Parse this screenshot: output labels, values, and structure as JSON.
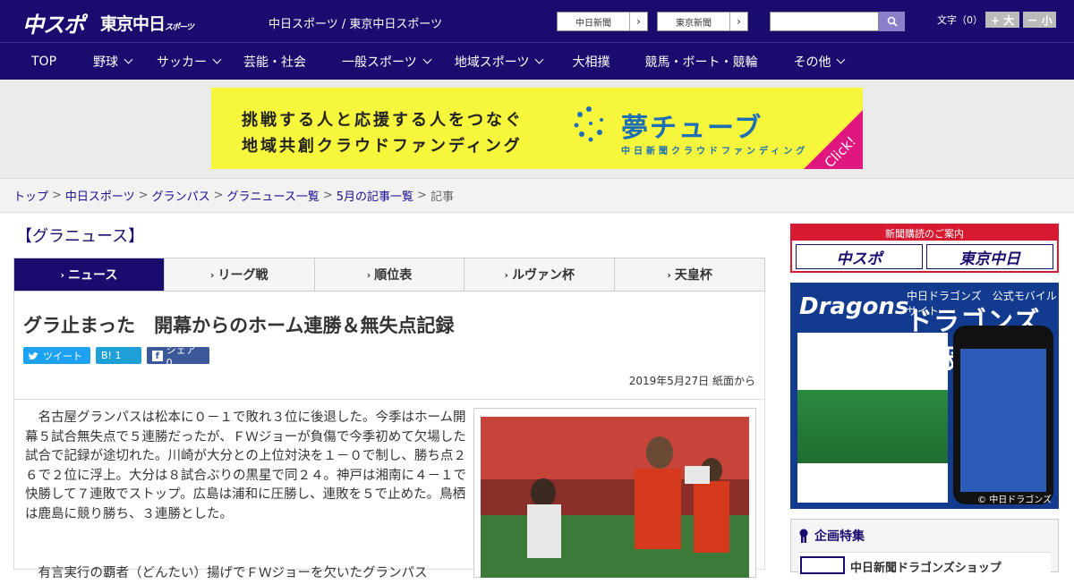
{
  "header": {
    "logo_chunichi": "中スポ",
    "logo_tokyo": "東京中日",
    "logo_tokyo_small": "スポーツ",
    "site_title": "中日スポーツ / 東京中日スポーツ",
    "paper_links": [
      {
        "label": "中日新聞"
      },
      {
        "label": "東京新聞"
      }
    ],
    "search_placeholder": "",
    "font_size_label": "文字（0）",
    "font_larger": "+ 大",
    "font_smaller": "－ 小"
  },
  "nav": [
    {
      "label": "TOP",
      "dropdown": false
    },
    {
      "label": "野球",
      "dropdown": true
    },
    {
      "label": "サッカー",
      "dropdown": true
    },
    {
      "label": "芸能・社会",
      "dropdown": false
    },
    {
      "label": "一般スポーツ",
      "dropdown": true
    },
    {
      "label": "地域スポーツ",
      "dropdown": true
    },
    {
      "label": "大相撲",
      "dropdown": false
    },
    {
      "label": "競馬・ボート・競輪",
      "dropdown": false
    },
    {
      "label": "その他",
      "dropdown": true
    }
  ],
  "banner": {
    "line1": "挑戦する人と応援する人をつなぐ",
    "line2": "地域共創クラウドファンディング",
    "logo": "夢チューブ",
    "sub": "中日新聞クラウドファンディング",
    "click": "Click!",
    "accent": "#f6f63c",
    "click_color": "#e0177e"
  },
  "breadcrumb": [
    {
      "label": "トップ"
    },
    {
      "label": "中日スポーツ"
    },
    {
      "label": "グランパス"
    },
    {
      "label": "グラニュース一覧"
    },
    {
      "label": "5月の記事一覧"
    }
  ],
  "breadcrumb_current": "記事",
  "category_title": "【グラニュース】",
  "tabs": [
    {
      "label": "ニュース",
      "active": true
    },
    {
      "label": "リーグ戦",
      "active": false
    },
    {
      "label": "順位表",
      "active": false
    },
    {
      "label": "ルヴァン杯",
      "active": false
    },
    {
      "label": "天皇杯",
      "active": false
    }
  ],
  "article": {
    "headline": "グラ止まった　開幕からのホーム連勝＆無失点記録",
    "share": {
      "tweet": "ツイート",
      "hatena": "B! 1",
      "facebook": "シェア 0"
    },
    "dateline": "2019年5月27日 紙面から",
    "paragraph1": "名古屋グランパスは松本に０－１で敗れ３位に後退した。今季はホーム開幕５試合無失点で５連勝だったが、ＦＷジョーが負傷で今季初めて欠場した試合で記録が途切れた。川崎が大分との上位対決を１－０で制し、勝ち点２６で２位に浮上。大分は８試合ぶりの黒星で同２４。神戸は湘南に４－１で快勝して７連敗でストップ。広島は浦和に圧勝し、連敗を５で止めた。鳥栖は鹿島に競り勝ち、３連勝とした。",
    "paragraph2": "有言実行の覇者（どんたい）揚げでＦＷジョーを欠いたグランパス"
  },
  "sidebar": {
    "subscribe_head": "新聞購読のご案内",
    "subscribe_logo1": "中スポ",
    "subscribe_logo2": "東京中日",
    "dragons_logo": "Dragons",
    "dragons_small": "中日ドラゴンズ　公式モバイルサイト",
    "dragons_big": "ドラゴンズ情報",
    "dragons_copy": "© 中日ドラゴンズ",
    "special_head": "企画特集",
    "special_item": "中日新聞ドラゴンズショップ"
  }
}
